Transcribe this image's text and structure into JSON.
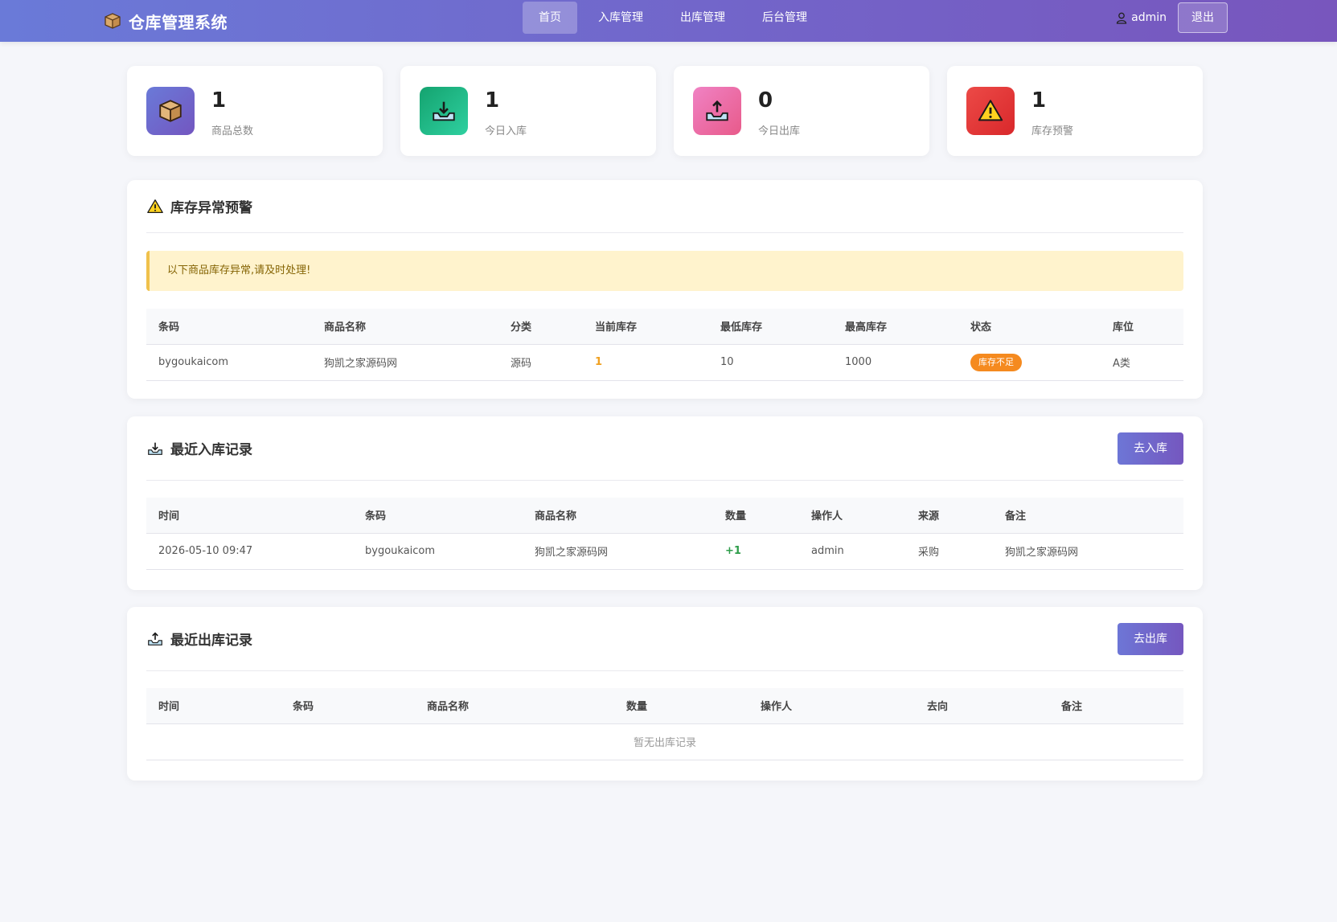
{
  "header": {
    "brand": "仓库管理系统",
    "brand_icon": "box-icon",
    "nav": [
      {
        "label": "首页",
        "active": true
      },
      {
        "label": "入库管理",
        "active": false
      },
      {
        "label": "出库管理",
        "active": false
      },
      {
        "label": "后台管理",
        "active": false
      }
    ],
    "username": "admin",
    "logout_label": "退出"
  },
  "stats": [
    {
      "value": "1",
      "label": "商品总数",
      "icon": "box-icon",
      "color": "#6b6fd6"
    },
    {
      "value": "1",
      "label": "今日入库",
      "icon": "inbox-in-icon",
      "color": "#1fb58a"
    },
    {
      "value": "0",
      "label": "今日出库",
      "icon": "inbox-out-icon",
      "color": "#ee6fb0"
    },
    {
      "value": "1",
      "label": "库存预警",
      "icon": "warning-icon",
      "color": "#e8413b"
    }
  ],
  "alerts": {
    "title": "库存异常预警",
    "notice": "以下商品库存异常,请及时处理!",
    "columns": [
      "条码",
      "商品名称",
      "分类",
      "当前库存",
      "最低库存",
      "最高库存",
      "状态",
      "库位"
    ],
    "rows": [
      {
        "barcode": "bygoukaicom",
        "name": "狗凯之家源码网",
        "category": "源码",
        "current": "1",
        "min": "10",
        "max": "1000",
        "status": "库存不足",
        "location": "A类"
      }
    ]
  },
  "inbound": {
    "title": "最近入库记录",
    "action_label": "去入库",
    "columns": [
      "时间",
      "条码",
      "商品名称",
      "数量",
      "操作人",
      "来源",
      "备注"
    ],
    "rows": [
      {
        "time": "2026-05-10 09:47",
        "barcode": "bygoukaicom",
        "name": "狗凯之家源码网",
        "qty": "+1",
        "operator": "admin",
        "source": "采购",
        "remark": "狗凯之家源码网"
      }
    ]
  },
  "outbound": {
    "title": "最近出库记录",
    "action_label": "去出库",
    "columns": [
      "时间",
      "条码",
      "商品名称",
      "数量",
      "操作人",
      "去向",
      "备注"
    ],
    "empty_text": "暂无出库记录"
  },
  "colors": {
    "accent": "#7363c8",
    "warning_amber": "#f0a020",
    "status_orange": "#f58a1f",
    "positive_green": "#2e9d4a"
  }
}
